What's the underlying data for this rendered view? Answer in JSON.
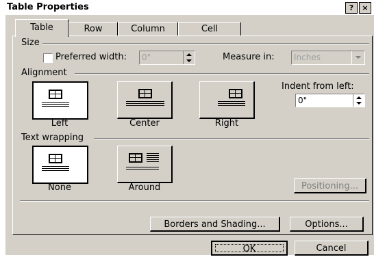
{
  "window": {
    "title": "Table Properties",
    "help_label": "?",
    "close_label": "×"
  },
  "tabs": [
    {
      "label": "Table",
      "active": true
    },
    {
      "label": "Row",
      "active": false
    },
    {
      "label": "Column",
      "active": false
    },
    {
      "label": "Cell",
      "active": false
    }
  ],
  "size": {
    "group_label": "Size",
    "preferred_width_label": "Preferred width:",
    "preferred_width_value": "0\"",
    "measure_in_label": "Measure in:",
    "measure_in_value": "Inches"
  },
  "alignment": {
    "group_label": "Alignment",
    "options": [
      "Left",
      "Center",
      "Right"
    ],
    "selected": "Left",
    "indent_label": "Indent from left:",
    "indent_value": "0\""
  },
  "text_wrapping": {
    "group_label": "Text wrapping",
    "options": [
      "None",
      "Around"
    ],
    "selected": "None",
    "positioning_label": "Positioning..."
  },
  "buttons": {
    "borders_shading": "Borders and Shading...",
    "options": "Options...",
    "ok": "OK",
    "cancel": "Cancel"
  }
}
